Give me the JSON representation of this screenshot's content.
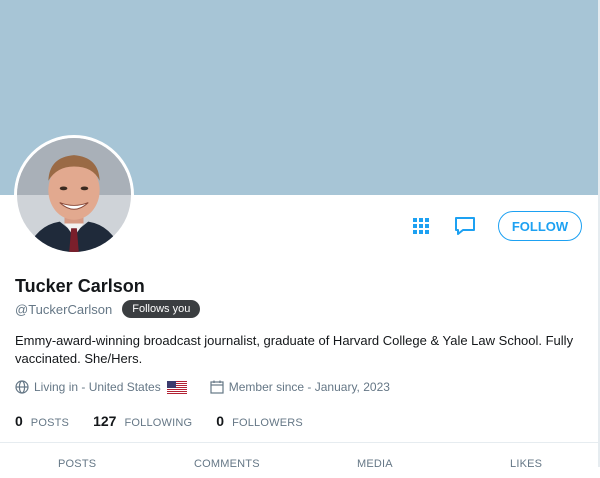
{
  "profile": {
    "name": "Tucker Carlson",
    "handle": "@TuckerCarlson",
    "follows_you": "Follows you",
    "bio": "Emmy-award-winning broadcast journalist, graduate of Harvard College & Yale Law School. Fully vaccinated. She/Hers.",
    "location": "Living in - United States",
    "member_since": "Member since - January, 2023",
    "banner_color": "#a7c5d6"
  },
  "actions": {
    "follow_label": "FOLLOW",
    "accent_color": "#1da1f2",
    "icons": [
      "grid-icon",
      "message-icon"
    ]
  },
  "stats": [
    {
      "count": "0",
      "label": "POSTS"
    },
    {
      "count": "127",
      "label": "FOLLOWING"
    },
    {
      "count": "0",
      "label": "FOLLOWERS"
    }
  ],
  "tabs": [
    {
      "label": "POSTS"
    },
    {
      "label": "COMMENTS"
    },
    {
      "label": "MEDIA"
    },
    {
      "label": "LIKES"
    }
  ]
}
